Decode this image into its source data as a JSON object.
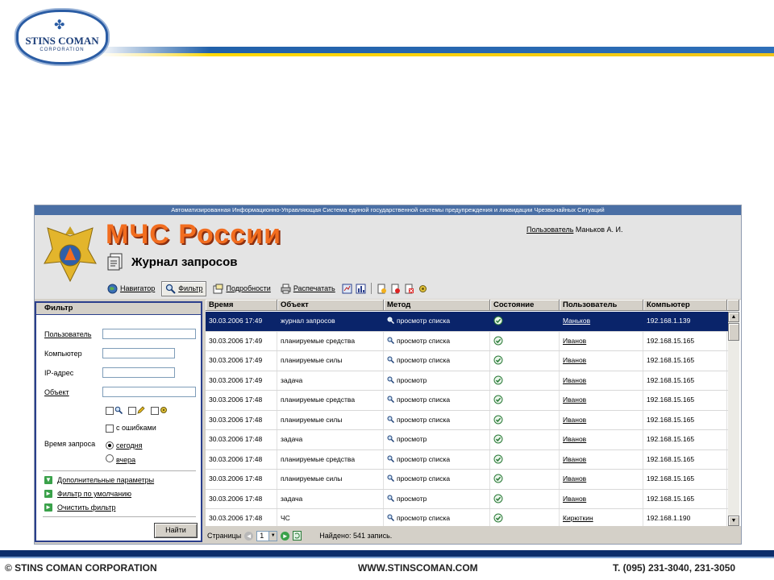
{
  "slide": {
    "logo_line1": "STINS COMAN",
    "logo_line2": "CORPORATION",
    "footer_left": "© STINS COMAN CORPORATION",
    "footer_center": "WWW.STINSCOMAN.COM",
    "footer_right": "Т. (095) 231-3040, 231-3050"
  },
  "app": {
    "banner": "Автоматизированная Информационно-Управляющая Система единой государственной системы предупреждения и ликвидации Чрезвычайных Ситуаций",
    "brand": "МЧС России",
    "page_title": "Журнал запросов",
    "user_label": "Пользователь",
    "user_name": "Маньков А. И."
  },
  "toolbar": {
    "navigator": "Навигатор",
    "filter": "Фильтр",
    "details": "Подробности",
    "print": "Распечатать"
  },
  "filter": {
    "title": "Фильтр",
    "user_label": "Пользователь",
    "computer_label": "Компьютер",
    "ip_label": "IP-адрес",
    "object_label": "Объект",
    "errors_label": "с ошибками",
    "time_label": "Время запроса",
    "today_label": "сегодня",
    "yesterday_label": "вчера",
    "link_more": "Дополнительные параметры",
    "link_default": "Фильтр по умолчанию",
    "link_clear": "Очистить фильтр",
    "find_button": "Найти"
  },
  "grid": {
    "columns": [
      "Время",
      "Объект",
      "Метод",
      "Состояние",
      "Пользователь",
      "Компьютер"
    ],
    "rows": [
      {
        "time": "30.03.2006 17:49",
        "object": "журнал запросов",
        "method": "просмотр списка",
        "user": "Маньков",
        "computer": "192.168.1.139",
        "selected": true
      },
      {
        "time": "30.03.2006 17:49",
        "object": "планируемые средства",
        "method": "просмотр списка",
        "user": "Иванов",
        "computer": "192.168.15.165"
      },
      {
        "time": "30.03.2006 17:49",
        "object": "планируемые силы",
        "method": "просмотр списка",
        "user": "Иванов",
        "computer": "192.168.15.165"
      },
      {
        "time": "30.03.2006 17:49",
        "object": "задача",
        "method": "просмотр",
        "user": "Иванов",
        "computer": "192.168.15.165"
      },
      {
        "time": "30.03.2006 17:48",
        "object": "планируемые средства",
        "method": "просмотр списка",
        "user": "Иванов",
        "computer": "192.168.15.165"
      },
      {
        "time": "30.03.2006 17:48",
        "object": "планируемые силы",
        "method": "просмотр списка",
        "user": "Иванов",
        "computer": "192.168.15.165"
      },
      {
        "time": "30.03.2006 17:48",
        "object": "задача",
        "method": "просмотр",
        "user": "Иванов",
        "computer": "192.168.15.165"
      },
      {
        "time": "30.03.2006 17:48",
        "object": "планируемые средства",
        "method": "просмотр списка",
        "user": "Иванов",
        "computer": "192.168.15.165"
      },
      {
        "time": "30.03.2006 17:48",
        "object": "планируемые силы",
        "method": "просмотр списка",
        "user": "Иванов",
        "computer": "192.168.15.165"
      },
      {
        "time": "30.03.2006 17:48",
        "object": "задача",
        "method": "просмотр",
        "user": "Иванов",
        "computer": "192.168.15.165"
      },
      {
        "time": "30.03.2006 17:48",
        "object": "ЧС",
        "method": "просмотр списка",
        "user": "Кирюткин",
        "computer": "192.168.1.190"
      }
    ]
  },
  "pager": {
    "pages_label": "Страницы",
    "current_page": "1",
    "found_text": "Найдено: 541 запись."
  },
  "colors": {
    "selection": "#0a246a",
    "brand_orange": "#f26d1f",
    "panel_border": "#2b3f8c"
  }
}
